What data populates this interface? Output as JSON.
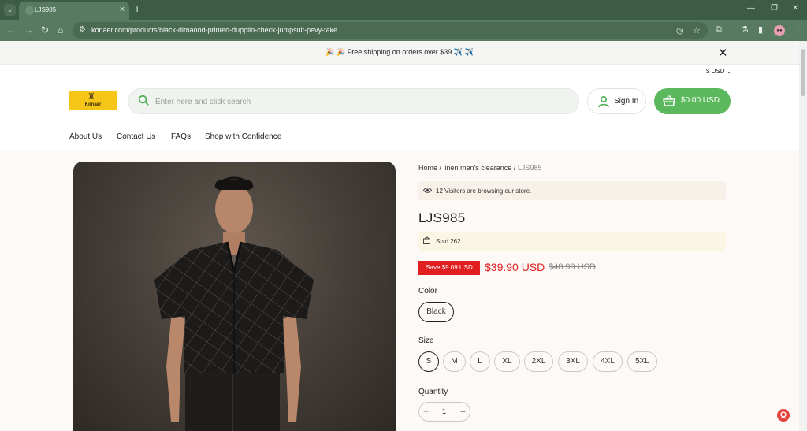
{
  "browser": {
    "tab_title": "LJS985",
    "url": "konaer.com/products/black-dimaond-printed-dupplin-check-jumpsuit-pevy-take"
  },
  "announcement": {
    "text": "🎉 🎉 Free shipping on orders over $39 ✈️ ✈️"
  },
  "header": {
    "currency": "$ USD",
    "logo_text": "Konaer",
    "search_placeholder": "Enter here and click search",
    "sign_in_label": "Sign In",
    "cart_label": "$0.00 USD"
  },
  "nav": {
    "items": [
      "About Us",
      "Contact Us",
      "FAQs",
      "Shop with Confidence"
    ]
  },
  "breadcrumb": {
    "home": "Home",
    "category": "linen men's clearance",
    "current": "LJS985"
  },
  "product": {
    "visitors_text": "12 Visitors are browsing our store.",
    "title": "LJS985",
    "sold_text": "Sold 262",
    "save_badge": "Save $9.09 USD",
    "price": "$39.90 USD",
    "compare_price": "$48.99 USD",
    "color_label": "Color",
    "colors": [
      "Black"
    ],
    "size_label": "Size",
    "sizes": [
      "S",
      "M",
      "L",
      "XL",
      "2XL",
      "3XL",
      "4XL",
      "5XL"
    ],
    "quantity_label": "Quantity",
    "quantity": "1"
  },
  "colors": {
    "accent_green": "#5cb85c",
    "sale_red": "#e02020",
    "browser_green": "#577a60"
  }
}
